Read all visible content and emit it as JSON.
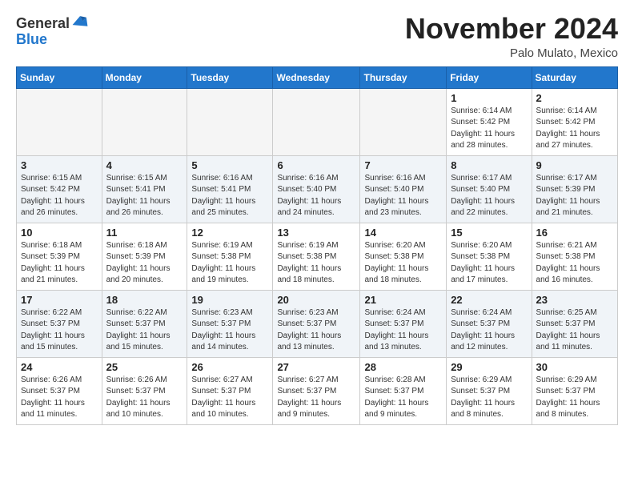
{
  "header": {
    "logo_general": "General",
    "logo_blue": "Blue",
    "month_title": "November 2024",
    "location": "Palo Mulato, Mexico"
  },
  "weekdays": [
    "Sunday",
    "Monday",
    "Tuesday",
    "Wednesday",
    "Thursday",
    "Friday",
    "Saturday"
  ],
  "weeks": [
    [
      {
        "day": "",
        "info": ""
      },
      {
        "day": "",
        "info": ""
      },
      {
        "day": "",
        "info": ""
      },
      {
        "day": "",
        "info": ""
      },
      {
        "day": "",
        "info": ""
      },
      {
        "day": "1",
        "info": "Sunrise: 6:14 AM\nSunset: 5:42 PM\nDaylight: 11 hours\nand 28 minutes."
      },
      {
        "day": "2",
        "info": "Sunrise: 6:14 AM\nSunset: 5:42 PM\nDaylight: 11 hours\nand 27 minutes."
      }
    ],
    [
      {
        "day": "3",
        "info": "Sunrise: 6:15 AM\nSunset: 5:42 PM\nDaylight: 11 hours\nand 26 minutes."
      },
      {
        "day": "4",
        "info": "Sunrise: 6:15 AM\nSunset: 5:41 PM\nDaylight: 11 hours\nand 26 minutes."
      },
      {
        "day": "5",
        "info": "Sunrise: 6:16 AM\nSunset: 5:41 PM\nDaylight: 11 hours\nand 25 minutes."
      },
      {
        "day": "6",
        "info": "Sunrise: 6:16 AM\nSunset: 5:40 PM\nDaylight: 11 hours\nand 24 minutes."
      },
      {
        "day": "7",
        "info": "Sunrise: 6:16 AM\nSunset: 5:40 PM\nDaylight: 11 hours\nand 23 minutes."
      },
      {
        "day": "8",
        "info": "Sunrise: 6:17 AM\nSunset: 5:40 PM\nDaylight: 11 hours\nand 22 minutes."
      },
      {
        "day": "9",
        "info": "Sunrise: 6:17 AM\nSunset: 5:39 PM\nDaylight: 11 hours\nand 21 minutes."
      }
    ],
    [
      {
        "day": "10",
        "info": "Sunrise: 6:18 AM\nSunset: 5:39 PM\nDaylight: 11 hours\nand 21 minutes."
      },
      {
        "day": "11",
        "info": "Sunrise: 6:18 AM\nSunset: 5:39 PM\nDaylight: 11 hours\nand 20 minutes."
      },
      {
        "day": "12",
        "info": "Sunrise: 6:19 AM\nSunset: 5:38 PM\nDaylight: 11 hours\nand 19 minutes."
      },
      {
        "day": "13",
        "info": "Sunrise: 6:19 AM\nSunset: 5:38 PM\nDaylight: 11 hours\nand 18 minutes."
      },
      {
        "day": "14",
        "info": "Sunrise: 6:20 AM\nSunset: 5:38 PM\nDaylight: 11 hours\nand 18 minutes."
      },
      {
        "day": "15",
        "info": "Sunrise: 6:20 AM\nSunset: 5:38 PM\nDaylight: 11 hours\nand 17 minutes."
      },
      {
        "day": "16",
        "info": "Sunrise: 6:21 AM\nSunset: 5:38 PM\nDaylight: 11 hours\nand 16 minutes."
      }
    ],
    [
      {
        "day": "17",
        "info": "Sunrise: 6:22 AM\nSunset: 5:37 PM\nDaylight: 11 hours\nand 15 minutes."
      },
      {
        "day": "18",
        "info": "Sunrise: 6:22 AM\nSunset: 5:37 PM\nDaylight: 11 hours\nand 15 minutes."
      },
      {
        "day": "19",
        "info": "Sunrise: 6:23 AM\nSunset: 5:37 PM\nDaylight: 11 hours\nand 14 minutes."
      },
      {
        "day": "20",
        "info": "Sunrise: 6:23 AM\nSunset: 5:37 PM\nDaylight: 11 hours\nand 13 minutes."
      },
      {
        "day": "21",
        "info": "Sunrise: 6:24 AM\nSunset: 5:37 PM\nDaylight: 11 hours\nand 13 minutes."
      },
      {
        "day": "22",
        "info": "Sunrise: 6:24 AM\nSunset: 5:37 PM\nDaylight: 11 hours\nand 12 minutes."
      },
      {
        "day": "23",
        "info": "Sunrise: 6:25 AM\nSunset: 5:37 PM\nDaylight: 11 hours\nand 11 minutes."
      }
    ],
    [
      {
        "day": "24",
        "info": "Sunrise: 6:26 AM\nSunset: 5:37 PM\nDaylight: 11 hours\nand 11 minutes."
      },
      {
        "day": "25",
        "info": "Sunrise: 6:26 AM\nSunset: 5:37 PM\nDaylight: 11 hours\nand 10 minutes."
      },
      {
        "day": "26",
        "info": "Sunrise: 6:27 AM\nSunset: 5:37 PM\nDaylight: 11 hours\nand 10 minutes."
      },
      {
        "day": "27",
        "info": "Sunrise: 6:27 AM\nSunset: 5:37 PM\nDaylight: 11 hours\nand 9 minutes."
      },
      {
        "day": "28",
        "info": "Sunrise: 6:28 AM\nSunset: 5:37 PM\nDaylight: 11 hours\nand 9 minutes."
      },
      {
        "day": "29",
        "info": "Sunrise: 6:29 AM\nSunset: 5:37 PM\nDaylight: 11 hours\nand 8 minutes."
      },
      {
        "day": "30",
        "info": "Sunrise: 6:29 AM\nSunset: 5:37 PM\nDaylight: 11 hours\nand 8 minutes."
      }
    ]
  ]
}
